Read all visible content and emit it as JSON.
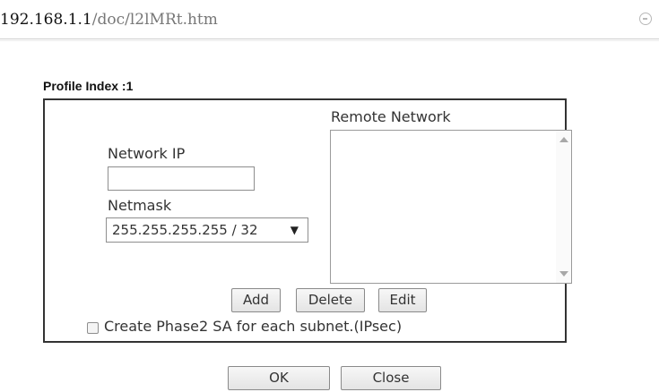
{
  "address_bar": {
    "host": "192.168.1.1",
    "path": "/doc/l2lMRt.htm"
  },
  "form": {
    "profile_index_label": "Profile Index :1",
    "remote_network_label": "Remote Network",
    "network_ip_label": "Network IP",
    "network_ip_value": "",
    "netmask_label": "Netmask",
    "netmask_selected": "255.255.255.255 / 32",
    "remote_network_items": [],
    "add_label": "Add",
    "delete_label": "Delete",
    "edit_label": "Edit",
    "phase2_checkbox_label": "Create Phase2 SA for each subnet.(IPsec)",
    "phase2_checked": false
  },
  "footer": {
    "ok_label": "OK",
    "close_label": "Close"
  }
}
